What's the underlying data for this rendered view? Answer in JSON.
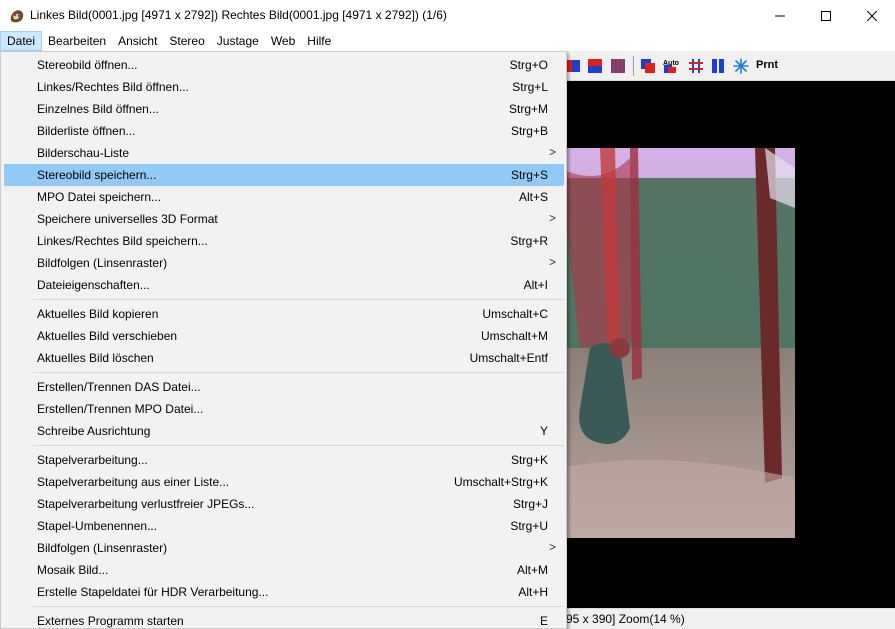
{
  "window": {
    "title": "Linkes Bild(0001.jpg [4971 x 2792]) Rechtes Bild(0001.jpg [4971 x 2792])  (1/6)",
    "controls": [
      "minimize-icon",
      "maximize-icon",
      "close-icon"
    ]
  },
  "menubar": [
    "Datei",
    "Bearbeiten",
    "Ansicht",
    "Stereo",
    "Justage",
    "Web",
    "Hilfe"
  ],
  "toolbar": {
    "icons": [
      "anaglyph-red-blue-icon",
      "split-red-blue-icon",
      "stripes-icon",
      "overlap-icon",
      "auto-align-icon",
      "grid-icon",
      "side-by-side-icon",
      "snowflake-icon",
      "print-icon"
    ],
    "auto_label": "Auto",
    "print_label": "Prnt"
  },
  "dropdown": {
    "items": [
      {
        "label": "Stereobild öffnen...",
        "shortcut": "Strg+O"
      },
      {
        "label": "Linkes/Rechtes Bild öffnen...",
        "shortcut": "Strg+L"
      },
      {
        "label": "Einzelnes Bild öffnen...",
        "shortcut": "Strg+M"
      },
      {
        "label": "Bilderliste öffnen...",
        "shortcut": "Strg+B"
      },
      {
        "label": "Bilderschau-Liste",
        "shortcut": "",
        "submenu": true
      },
      {
        "label": "Stereobild speichern...",
        "shortcut": "Strg+S",
        "highlighted": true
      },
      {
        "label": "MPO Datei speichern...",
        "shortcut": "Alt+S"
      },
      {
        "label": "Speichere universelles 3D Format",
        "shortcut": "",
        "submenu": true
      },
      {
        "label": "Linkes/Rechtes Bild speichern...",
        "shortcut": "Strg+R"
      },
      {
        "label": "Bildfolgen (Linsenraster)",
        "shortcut": "",
        "submenu": true
      },
      {
        "label": "Dateieigenschaften...",
        "shortcut": "Alt+I"
      },
      {
        "label": "Aktuelles Bild kopieren",
        "shortcut": "Umschalt+C"
      },
      {
        "label": "Aktuelles Bild verschieben",
        "shortcut": "Umschalt+M"
      },
      {
        "label": "Aktuelles Bild löschen",
        "shortcut": "Umschalt+Entf"
      },
      {
        "label": "Erstellen/Trennen DAS Datei...",
        "shortcut": ""
      },
      {
        "label": "Erstellen/Trennen MPO Datei...",
        "shortcut": ""
      },
      {
        "label": "Schreibe Ausrichtung",
        "shortcut": "Y"
      },
      {
        "label": "Stapelverarbeitung...",
        "shortcut": "Strg+K"
      },
      {
        "label": "Stapelverarbeitung aus einer Liste...",
        "shortcut": "Umschalt+Strg+K"
      },
      {
        "label": "Stapelverarbeitung verlustfreier JPEGs...",
        "shortcut": "Strg+J"
      },
      {
        "label": "Stapel-Umbenennen...",
        "shortcut": "Strg+U"
      },
      {
        "label": "Bildfolgen (Linsenraster)",
        "shortcut": "",
        "submenu": true
      },
      {
        "label": "Mosaik Bild...",
        "shortcut": "Alt+M"
      },
      {
        "label": "Erstelle Stapeldatei für HDR Verarbeitung...",
        "shortcut": "Alt+H"
      },
      {
        "label": "Externes Programm starten",
        "shortcut": "E"
      }
    ],
    "submenu_arrow": ">"
  },
  "status": {
    "text": "95 x 390]  Zoom(14 %)"
  },
  "colors": {
    "highlight": "#91c9f7",
    "menu_bg": "#f2f2f2",
    "canvas_bg": "#000000",
    "active_menu_bg": "#cce8ff"
  }
}
